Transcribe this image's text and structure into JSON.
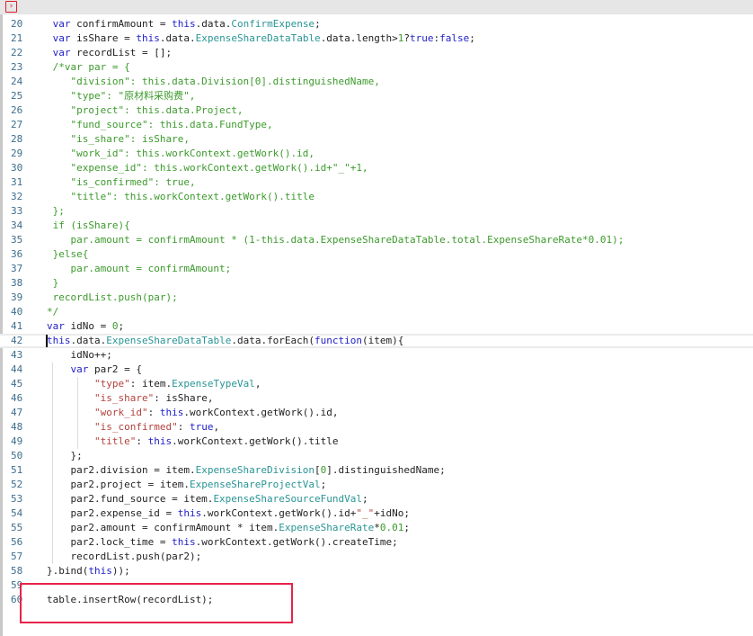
{
  "toolbar": {
    "run_icon": "run-icon",
    "run_glyph": "›"
  },
  "editor": {
    "current_line": 42,
    "colors": {
      "keyword": "#2121c9",
      "property": "#2a9494",
      "string": "#b3413d",
      "comment": "#3c9a2c",
      "number": "#3c9a2c",
      "highlight_box": "#e8234a"
    },
    "lines": [
      {
        "n": "20",
        "t": [
          [
            " ",
            "plain"
          ],
          [
            "var",
            "kw"
          ],
          [
            " confirmAmount = ",
            "plain"
          ],
          [
            "this",
            "kw"
          ],
          [
            ".data.",
            "plain"
          ],
          [
            "ConfirmExpense",
            "prop"
          ],
          [
            ";",
            "plain"
          ]
        ]
      },
      {
        "n": "21",
        "t": [
          [
            " ",
            "plain"
          ],
          [
            "var",
            "kw"
          ],
          [
            " isShare = ",
            "plain"
          ],
          [
            "this",
            "kw"
          ],
          [
            ".data.",
            "plain"
          ],
          [
            "ExpenseShareDataTable",
            "prop"
          ],
          [
            ".data.length>",
            "plain"
          ],
          [
            "1",
            "num"
          ],
          [
            "?",
            "plain"
          ],
          [
            "true",
            "kw"
          ],
          [
            ":",
            "plain"
          ],
          [
            "false",
            "kw"
          ],
          [
            ";",
            "plain"
          ]
        ]
      },
      {
        "n": "22",
        "t": [
          [
            " ",
            "plain"
          ],
          [
            "var",
            "kw"
          ],
          [
            " recordList = [];",
            "plain"
          ]
        ]
      },
      {
        "n": "23",
        "t": [
          [
            " /*var par = {",
            "cm"
          ]
        ]
      },
      {
        "n": "24",
        "t": [
          [
            "    \"division\": this.data.Division[0].distinguishedName,",
            "cm"
          ]
        ]
      },
      {
        "n": "25",
        "t": [
          [
            "    \"type\": \"原材料采购费\",",
            "cm"
          ]
        ]
      },
      {
        "n": "26",
        "t": [
          [
            "    \"project\": this.data.Project,",
            "cm"
          ]
        ]
      },
      {
        "n": "27",
        "t": [
          [
            "    \"fund_source\": this.data.FundType,",
            "cm"
          ]
        ]
      },
      {
        "n": "28",
        "t": [
          [
            "    \"is_share\": isShare,",
            "cm"
          ]
        ]
      },
      {
        "n": "29",
        "t": [
          [
            "    \"work_id\": this.workContext.getWork().id,",
            "cm"
          ]
        ]
      },
      {
        "n": "30",
        "t": [
          [
            "    \"expense_id\": this.workContext.getWork().id+\"_\"+1,",
            "cm"
          ]
        ]
      },
      {
        "n": "31",
        "t": [
          [
            "    \"is_confirmed\": true,",
            "cm"
          ]
        ]
      },
      {
        "n": "32",
        "t": [
          [
            "    \"title\": this.workContext.getWork().title",
            "cm"
          ]
        ]
      },
      {
        "n": "33",
        "t": [
          [
            " };",
            "cm"
          ]
        ]
      },
      {
        "n": "34",
        "t": [
          [
            " if (isShare){",
            "cm"
          ]
        ]
      },
      {
        "n": "35",
        "t": [
          [
            "    par.amount = confirmAmount * (1-this.data.ExpenseShareDataTable.total.ExpenseShareRate*0.01);",
            "cm"
          ]
        ]
      },
      {
        "n": "36",
        "t": [
          [
            " }else{",
            "cm"
          ]
        ]
      },
      {
        "n": "37",
        "t": [
          [
            "    par.amount = confirmAmount;",
            "cm"
          ]
        ]
      },
      {
        "n": "38",
        "t": [
          [
            " }",
            "cm"
          ]
        ]
      },
      {
        "n": "39",
        "t": [
          [
            " recordList.push(par);",
            "cm"
          ]
        ]
      },
      {
        "n": "40",
        "t": [
          [
            "*/",
            "cm"
          ]
        ]
      },
      {
        "n": "41",
        "t": [
          [
            "var",
            "kw"
          ],
          [
            " idNo = ",
            "plain"
          ],
          [
            "0",
            "num"
          ],
          [
            ";",
            "plain"
          ]
        ]
      },
      {
        "n": "42",
        "t": [
          [
            "this",
            "kw"
          ],
          [
            ".data.",
            "plain"
          ],
          [
            "ExpenseShareDataTable",
            "prop"
          ],
          [
            ".data.forEach(",
            "plain"
          ],
          [
            "function",
            "kw"
          ],
          [
            "(item){",
            "plain"
          ]
        ]
      },
      {
        "n": "43",
        "t": [
          [
            "    idNo++;",
            "plain"
          ]
        ]
      },
      {
        "n": "44",
        "t": [
          [
            "    ",
            "plain"
          ],
          [
            "var",
            "kw"
          ],
          [
            " par2 = {",
            "plain"
          ]
        ]
      },
      {
        "n": "45",
        "t": [
          [
            "        ",
            "plain"
          ],
          [
            "\"type\"",
            "str"
          ],
          [
            ": item.",
            "plain"
          ],
          [
            "ExpenseTypeVal",
            "prop"
          ],
          [
            ",",
            "plain"
          ]
        ]
      },
      {
        "n": "46",
        "t": [
          [
            "        ",
            "plain"
          ],
          [
            "\"is_share\"",
            "str"
          ],
          [
            ": isShare,",
            "plain"
          ]
        ]
      },
      {
        "n": "47",
        "t": [
          [
            "        ",
            "plain"
          ],
          [
            "\"work_id\"",
            "str"
          ],
          [
            ": ",
            "plain"
          ],
          [
            "this",
            "kw"
          ],
          [
            ".workContext.getWork().id,",
            "plain"
          ]
        ]
      },
      {
        "n": "48",
        "t": [
          [
            "        ",
            "plain"
          ],
          [
            "\"is_confirmed\"",
            "str"
          ],
          [
            ": ",
            "plain"
          ],
          [
            "true",
            "kw"
          ],
          [
            ",",
            "plain"
          ]
        ]
      },
      {
        "n": "49",
        "t": [
          [
            "        ",
            "plain"
          ],
          [
            "\"title\"",
            "str"
          ],
          [
            ": ",
            "plain"
          ],
          [
            "this",
            "kw"
          ],
          [
            ".workContext.getWork().title",
            "plain"
          ]
        ]
      },
      {
        "n": "50",
        "t": [
          [
            "    };",
            "plain"
          ]
        ]
      },
      {
        "n": "51",
        "t": [
          [
            "    par2.division = item.",
            "plain"
          ],
          [
            "ExpenseShareDivision",
            "prop"
          ],
          [
            "[",
            "plain"
          ],
          [
            "0",
            "num"
          ],
          [
            "].distinguishedName;",
            "plain"
          ]
        ]
      },
      {
        "n": "52",
        "t": [
          [
            "    par2.project = item.",
            "plain"
          ],
          [
            "ExpenseShareProjectVal",
            "prop"
          ],
          [
            ";",
            "plain"
          ]
        ]
      },
      {
        "n": "53",
        "t": [
          [
            "    par2.fund_source = item.",
            "plain"
          ],
          [
            "ExpenseShareSourceFundVal",
            "prop"
          ],
          [
            ";",
            "plain"
          ]
        ]
      },
      {
        "n": "54",
        "t": [
          [
            "    par2.expense_id = ",
            "plain"
          ],
          [
            "this",
            "kw"
          ],
          [
            ".workContext.getWork().id+",
            "plain"
          ],
          [
            "\"_\"",
            "str"
          ],
          [
            "+idNo;",
            "plain"
          ]
        ]
      },
      {
        "n": "55",
        "t": [
          [
            "    par2.amount = confirmAmount * item.",
            "plain"
          ],
          [
            "ExpenseShareRate",
            "prop"
          ],
          [
            "*",
            "plain"
          ],
          [
            "0.01",
            "num"
          ],
          [
            ";",
            "plain"
          ]
        ]
      },
      {
        "n": "56",
        "t": [
          [
            "    par2.lock_time = ",
            "plain"
          ],
          [
            "this",
            "kw"
          ],
          [
            ".workContext.getWork().createTime;",
            "plain"
          ]
        ]
      },
      {
        "n": "57",
        "t": [
          [
            "    recordList.push(par2);",
            "plain"
          ]
        ]
      },
      {
        "n": "58",
        "t": [
          [
            "}.bind(",
            "plain"
          ],
          [
            "this",
            "kw"
          ],
          [
            "));",
            "plain"
          ]
        ]
      },
      {
        "n": "59",
        "t": []
      },
      {
        "n": "60",
        "t": [
          [
            "table.insertRow(recordList);",
            "plain"
          ]
        ]
      }
    ]
  }
}
